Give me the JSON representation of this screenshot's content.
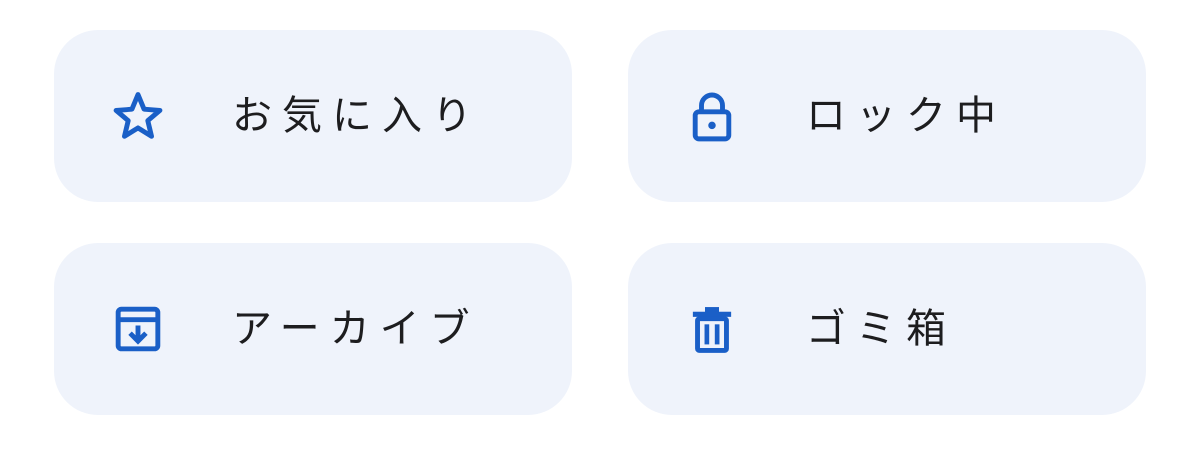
{
  "accent_color": "#1a5fc7",
  "tile_background": "#eff3fb",
  "tiles": [
    {
      "label": "お気に入り",
      "icon": "star-icon"
    },
    {
      "label": "ロック中",
      "icon": "lock-icon"
    },
    {
      "label": "アーカイブ",
      "icon": "archive-icon"
    },
    {
      "label": "ゴミ箱",
      "icon": "trash-icon"
    }
  ]
}
